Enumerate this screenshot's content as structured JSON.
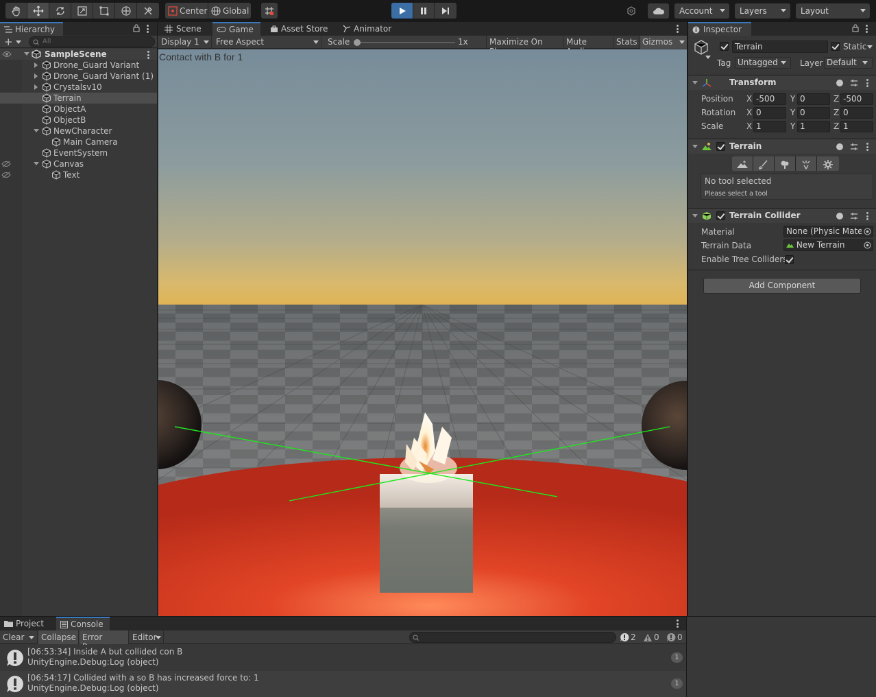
{
  "toolbar": {
    "tools": [
      "hand-tool",
      "move-tool",
      "rotate-tool",
      "scale-tool",
      "rect-tool",
      "transform-tool",
      "custom-tool"
    ],
    "pivot_label": "Center",
    "space_label": "Global",
    "account_label": "Account",
    "layers_label": "Layers",
    "layout_label": "Layout"
  },
  "hierarchy": {
    "tab_label": "Hierarchy",
    "search_placeholder": "All",
    "scene_name": "SampleScene",
    "items": [
      {
        "label": "Drone_Guard Variant"
      },
      {
        "label": "Drone_Guard Variant (1)"
      },
      {
        "label": "Crystalsv10"
      },
      {
        "label": "Terrain"
      },
      {
        "label": "ObjectA"
      },
      {
        "label": "ObjectB"
      },
      {
        "label": "NewCharacter"
      },
      {
        "label": "Main Camera"
      },
      {
        "label": "EventSystem"
      },
      {
        "label": "Canvas"
      },
      {
        "label": "Text"
      }
    ]
  },
  "center": {
    "tabs": [
      "Scene",
      "Game",
      "Asset Store",
      "Animator"
    ],
    "display_label": "Display 1",
    "aspect_label": "Free Aspect",
    "scale_label": "Scale",
    "scale_value": "1x",
    "buttons": [
      "Maximize On Play",
      "Mute Audio",
      "Stats",
      "Gizmos"
    ],
    "overlay_text": "Contact with B for 1"
  },
  "inspector": {
    "tab_label": "Inspector",
    "object_name": "Terrain",
    "static_label": "Static",
    "tag_label": "Tag",
    "tag_value": "Untagged",
    "layer_label": "Layer",
    "layer_value": "Default",
    "transform": {
      "title": "Transform",
      "rows": [
        {
          "label": "Position",
          "x": "-500",
          "y": "0",
          "z": "-500"
        },
        {
          "label": "Rotation",
          "x": "0",
          "y": "0",
          "z": "0"
        },
        {
          "label": "Scale",
          "x": "1",
          "y": "1",
          "z": "1"
        }
      ],
      "axis_x": "X",
      "axis_y": "Y",
      "axis_z": "Z"
    },
    "terrain": {
      "title": "Terrain",
      "no_tool": "No tool selected",
      "please": "Please select a tool"
    },
    "collider": {
      "title": "Terrain Collider",
      "material_label": "Material",
      "material_value": "None (Physic Material)",
      "data_label": "Terrain Data",
      "data_value": "New Terrain",
      "trees_label": "Enable Tree Colliders"
    },
    "add_component": "Add Component"
  },
  "console": {
    "tabs": [
      "Project",
      "Console"
    ],
    "clear": "Clear",
    "collapse": "Collapse",
    "error_pause": "Error Pause",
    "editor": "Editor",
    "count_log": "2",
    "count_warn": "0",
    "count_err": "0",
    "entries": [
      {
        "line1": "[06:53:34] Inside A but collided con B",
        "line2": "UnityEngine.Debug:Log (object)",
        "count": "1"
      },
      {
        "line1": "[06:54:17] Collided with a so B has increased force to: 1",
        "line2": "UnityEngine.Debug:Log (object)",
        "count": "1"
      }
    ]
  },
  "colors": {
    "accent": "#3a79bb",
    "play_active": "#3b6ea5",
    "gizmo_line": "#1ee81e",
    "platform": "#c4301c"
  }
}
